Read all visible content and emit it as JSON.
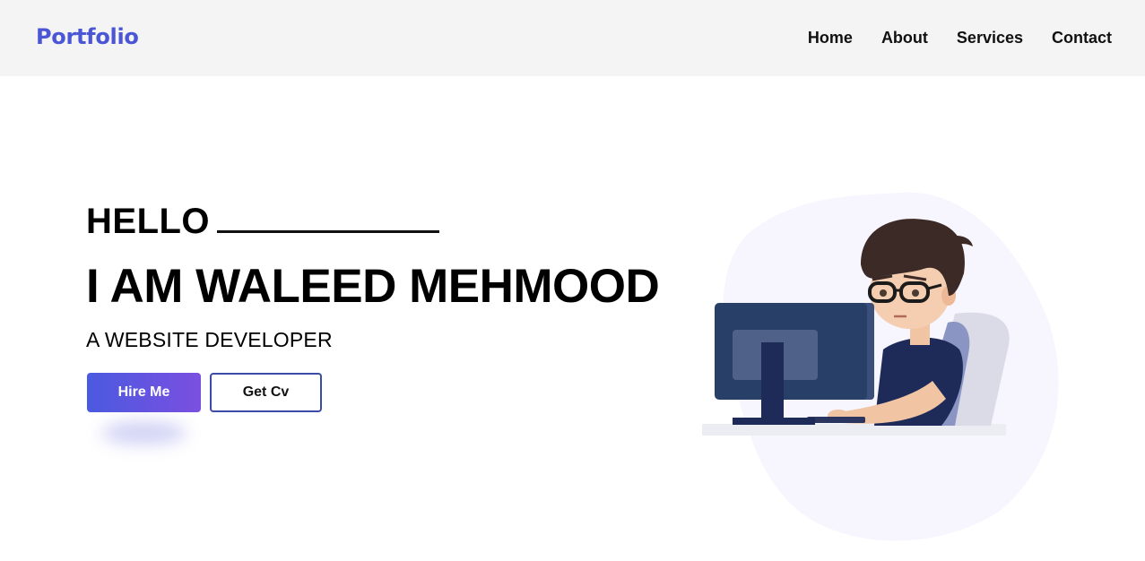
{
  "navbar": {
    "logo": "Portfolio",
    "links": [
      "Home",
      "About",
      "Services",
      "Contact"
    ]
  },
  "hero": {
    "greeting": "HELLO",
    "name": "I AM WALEED MEHMOOD",
    "subtitle": "A WEBSITE DEVELOPER",
    "hire_button": "Hire Me",
    "cv_button": "Get Cv"
  },
  "colors": {
    "brand": "#4a56d6",
    "navbar_bg": "#f4f4f4",
    "hire_gradient_start": "#4a5ae0",
    "hire_gradient_end": "#7b4fe0",
    "cv_border": "#3c4aa8"
  },
  "illustration": {
    "subject": "developer-at-computer-illustration"
  }
}
